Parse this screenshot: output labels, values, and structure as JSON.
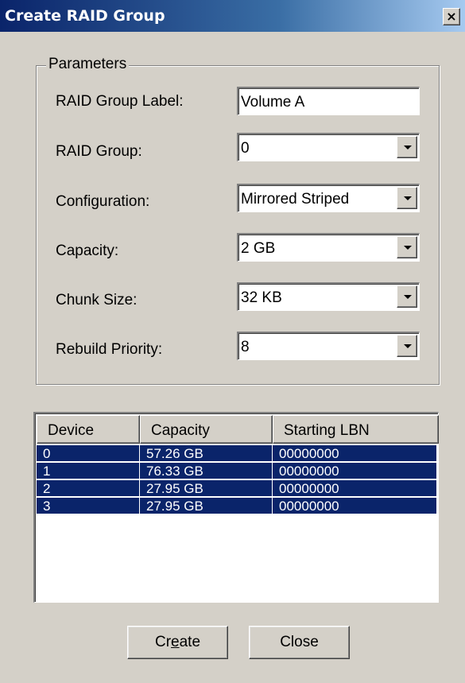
{
  "window": {
    "title": "Create RAID Group",
    "close_glyph": "×"
  },
  "parameters": {
    "legend": "Parameters",
    "fields": [
      {
        "label": "RAID Group Label:",
        "value": "Volume A"
      },
      {
        "label": "RAID Group:",
        "value": "0"
      },
      {
        "label": "Configuration:",
        "value": "Mirrored Striped"
      },
      {
        "label": "Capacity:",
        "value": "2 GB"
      },
      {
        "label": "Chunk Size:",
        "value": "32 KB"
      },
      {
        "label": "Rebuild Priority:",
        "value": "8"
      }
    ]
  },
  "table": {
    "columns": [
      "Device",
      "Capacity",
      "Starting LBN"
    ],
    "rows": [
      [
        "0",
        "57.26 GB",
        "00000000"
      ],
      [
        "1",
        "76.33 GB",
        "00000000"
      ],
      [
        "2",
        "27.95 GB",
        "00000000"
      ],
      [
        "3",
        "27.95 GB",
        "00000000"
      ]
    ],
    "selection_color": "#0a246a"
  },
  "buttons": {
    "create": {
      "before": "Cr",
      "mnemonic": "e",
      "after": "ate"
    },
    "close": "Close"
  }
}
